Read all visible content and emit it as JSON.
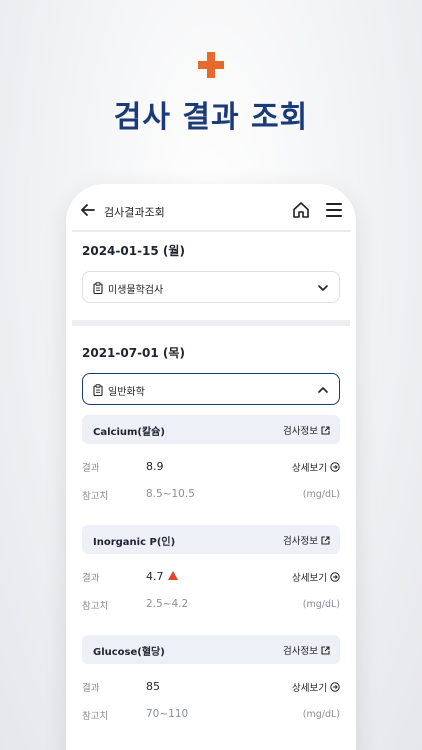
{
  "hero": {
    "title": "검사 결과 조회"
  },
  "appbar": {
    "title": "검사결과조회"
  },
  "groups": [
    {
      "date": "2024-01-15 (월)",
      "category": "미생물학검사",
      "expanded": false
    },
    {
      "date": "2021-07-01 (목)",
      "category": "일반화학",
      "expanded": true
    }
  ],
  "tests": [
    {
      "name": "Calcium(칼슘)",
      "info_label": "검사정보",
      "result_label": "결과",
      "result_value": "8.9",
      "high": false,
      "detail_label": "상세보기",
      "ref_label": "참고치",
      "ref_value": "8.5~10.5",
      "unit": "(mg/dL)"
    },
    {
      "name": "Inorganic P(인)",
      "info_label": "검사정보",
      "result_label": "결과",
      "result_value": "4.7",
      "high": true,
      "detail_label": "상세보기",
      "ref_label": "참고치",
      "ref_value": "2.5~4.2",
      "unit": "(mg/dL)"
    },
    {
      "name": "Glucose(혈당)",
      "info_label": "검사정보",
      "result_label": "결과",
      "result_value": "85",
      "high": false,
      "detail_label": "상세보기",
      "ref_label": "참고치",
      "ref_value": "70~110",
      "unit": "(mg/dL)"
    }
  ],
  "colors": {
    "accent": "#e8692c",
    "brand": "#1a3a78",
    "alert": "#e0452e",
    "card": "#edf1f7"
  }
}
